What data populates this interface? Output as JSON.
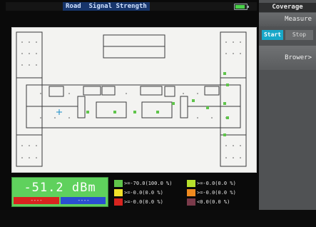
{
  "status_bar": {
    "title": "Road  Signal Strength"
  },
  "sidebar": {
    "title": "Coverage",
    "measure_label": "Measure",
    "start_label": "Start",
    "stop_label": "Stop",
    "browse_label": "Brower>"
  },
  "reading": {
    "value": "-51.2 dBm",
    "left_placeholder": "----",
    "right_placeholder": "----"
  },
  "legend": [
    {
      "color": "#5fc44a",
      "label": ">=-70.0(100.0 %)"
    },
    {
      "color": "#b7e02c",
      "label": ">=-0.0(0.0 %)"
    },
    {
      "color": "#f2e12a",
      "label": ">=-0.0(0.0 %)"
    },
    {
      "color": "#f08a1f",
      "label": ">=-0.0(0.0 %)"
    },
    {
      "color": "#d8241f",
      "label": ">=-0.0(0.0 %)"
    },
    {
      "color": "#7a3a4a",
      "label": "<0.0(0.0 %)"
    }
  ],
  "colors": {
    "accent": "#18a7c8",
    "title_bg": "#17356b",
    "signal_good": "#5fd15d"
  }
}
